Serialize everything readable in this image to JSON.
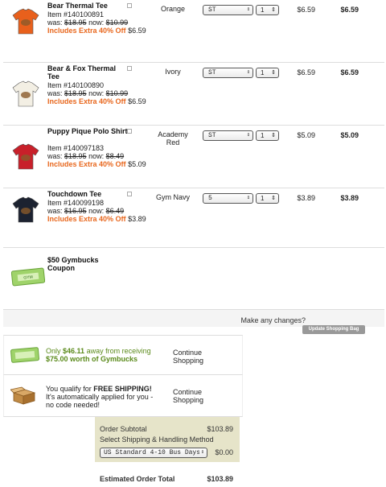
{
  "items": [
    {
      "name": "Bear Thermal Tee",
      "item_no": "Item #140100891",
      "was_label": "was:",
      "was": "$18.95",
      "now_label": "now:",
      "now": "$10.99",
      "promo": "Includes Extra 40% Off",
      "promo_price": "$6.59",
      "color": "Orange",
      "size": "ST",
      "qty": "1",
      "price": "$6.59",
      "total": "$6.59",
      "shirt_color": "#e8601c"
    },
    {
      "name": "Bear & Fox Thermal Tee",
      "item_no": "Item #140100890",
      "was_label": "was:",
      "was": "$18.95",
      "now_label": "now:",
      "now": "$10.99",
      "promo": "Includes Extra 40% Off",
      "promo_price": "$6.59",
      "color": "Ivory",
      "size": "ST",
      "qty": "1",
      "price": "$6.59",
      "total": "$6.59",
      "shirt_color": "#f3efe4"
    },
    {
      "name": "Puppy Pique Polo Shirt",
      "item_no": "Item #140097183",
      "was_label": "was:",
      "was": "$18.95",
      "now_label": "now:",
      "now": "$8.49",
      "promo": "Includes Extra 40% Off",
      "promo_price": "$5.09",
      "color": "Academy Red",
      "size": "ST",
      "qty": "1",
      "price": "$5.09",
      "total": "$5.09",
      "shirt_color": "#c8202a"
    },
    {
      "name": "Touchdown Tee",
      "item_no": "Item #140099198",
      "was_label": "was:",
      "was": "$16.95",
      "now_label": "now:",
      "now": "$6.49",
      "promo": "Includes Extra 40% Off",
      "promo_price": "$3.89",
      "color": "Gym Navy",
      "size": "5",
      "qty": "1",
      "price": "$3.89",
      "total": "$3.89",
      "shirt_color": "#1c2230"
    }
  ],
  "coupon": {
    "name": "$50 Gymbucks Coupon"
  },
  "changes": {
    "text": "Make any changes?",
    "update_button": "Update Shopping Bag"
  },
  "gymbucks_promo": {
    "prefix": "Only",
    "amount": "$46.11",
    "middle": "away from receiving",
    "reward": "$75.00 worth of Gymbucks",
    "continue": "Continue Shopping"
  },
  "shipping_promo": {
    "line1_prefix": "You qualify for",
    "line1_bold": "FREE SHIPPING!",
    "line2": "It's automatically applied for you - no code needed!",
    "continue": "Continue Shopping"
  },
  "summary": {
    "subtotal_label": "Order Subtotal",
    "subtotal_value": "$103.89",
    "shipping_label": "Select Shipping & Handling Method",
    "shipping_option": "US Standard 4-10 Bus Days",
    "shipping_value": "$0.00",
    "estimated_label": "Estimated Order Total",
    "estimated_value": "$103.89"
  }
}
